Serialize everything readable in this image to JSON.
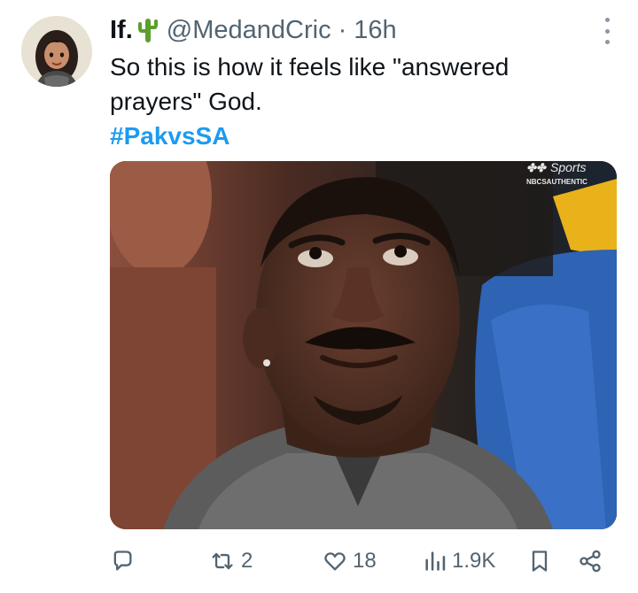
{
  "tweet": {
    "author_name": "If.",
    "author_emoji_icon": "cactus-icon",
    "handle": "@MedandCric",
    "separator": "·",
    "time": "16h",
    "text_line1": "So this is how it feels like \"answered",
    "text_line2": "prayers\" God.",
    "hashtag": "#PakvsSA"
  },
  "media": {
    "watermark_line1": "Sports",
    "watermark_line2": "NBCSAUTHENTIC"
  },
  "actions": {
    "reply_count": "",
    "retweet_count": "2",
    "like_count": "18",
    "views_count": "1.9K"
  },
  "colors": {
    "text": "#0f1419",
    "secondary": "#536471",
    "accent": "#1d9bf0"
  }
}
